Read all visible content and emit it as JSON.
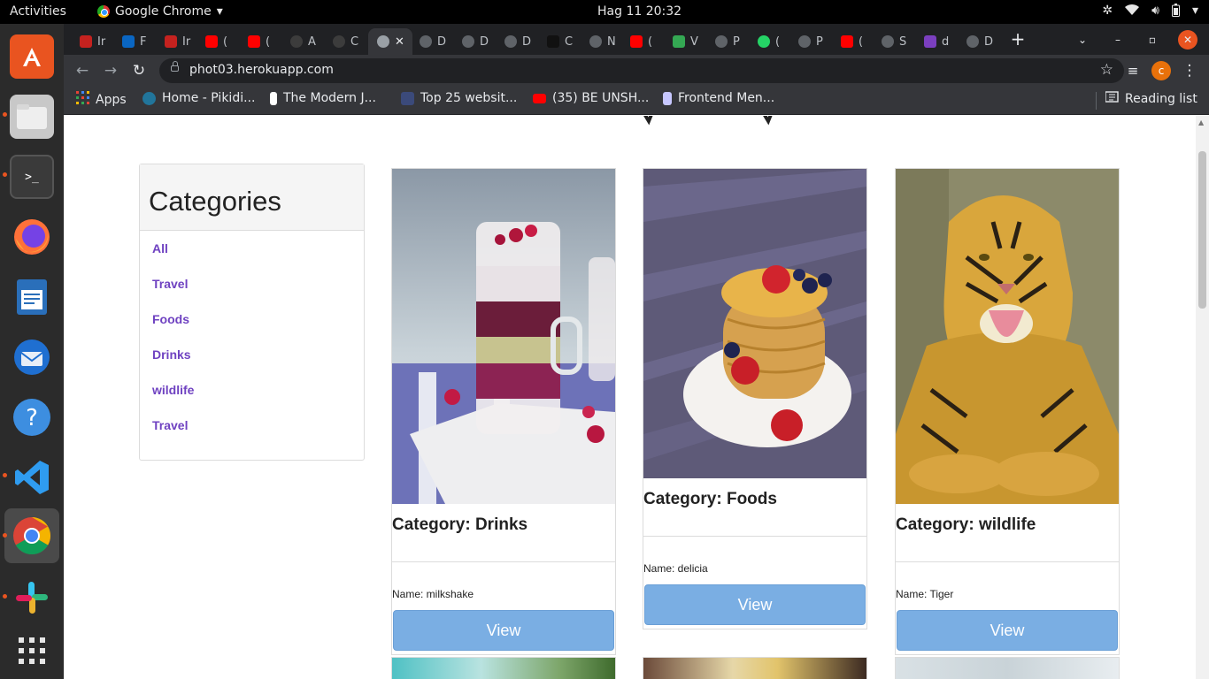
{
  "topbar": {
    "activities": "Activities",
    "app_name": "Google Chrome",
    "clock": "Hag 11  20:32"
  },
  "browser": {
    "url": "phot03.herokuapp.com",
    "profile_initial": "c",
    "tabs": [
      "Ir",
      "F",
      "Ir",
      "(",
      "(",
      "",
      "A",
      "C",
      "",
      "D",
      "D",
      "D",
      "C",
      "N",
      "(",
      "V",
      "P",
      "(",
      "P",
      "(",
      "S",
      "d",
      "D"
    ],
    "bookmarks": [
      {
        "label": "Apps",
        "color": "#ea4335"
      },
      {
        "label": "Home - Pikidi...",
        "color": "#21759b"
      },
      {
        "label": "The Modern J...",
        "color": "#ffffff"
      },
      {
        "label": "Top 25 websit...",
        "color": "#3b4a7a"
      },
      {
        "label": "(35) BE UNSH...",
        "color": "#ff0000"
      },
      {
        "label": "Frontend Men...",
        "color": "#c7c7ff"
      }
    ],
    "reading_list": "Reading list"
  },
  "page": {
    "categories_title": "Categories",
    "categories": [
      "All",
      "Travel",
      "Foods",
      "Drinks",
      "wildlife",
      "Travel"
    ],
    "cards": [
      {
        "category": "Category: Drinks",
        "name": "Name: milkshake",
        "view": "View"
      },
      {
        "category": "Category: Foods",
        "name": "Name: delicia",
        "view": "View"
      },
      {
        "category": "Category: wildlife",
        "name": "Name: Tiger",
        "view": "View"
      }
    ]
  },
  "colors": {
    "link": "#6f42c1",
    "view_button": "#7aaee3",
    "ubuntu_accent": "#e95420"
  }
}
